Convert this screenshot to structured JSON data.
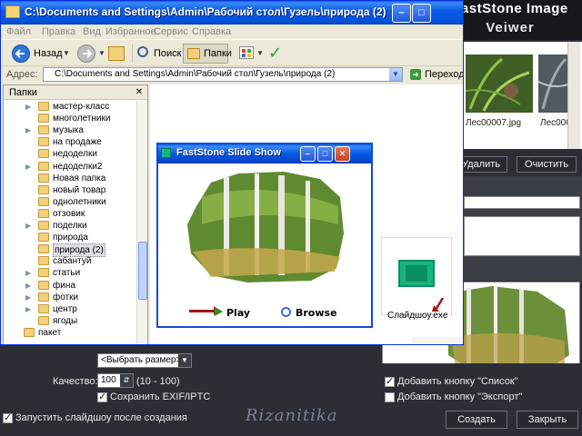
{
  "fs_app": {
    "title_line1": "FastStone Image",
    "title_line2": "Veiwer",
    "thumbs": [
      {
        "label": "Лес00007.jpg"
      },
      {
        "label": "Лес000"
      }
    ],
    "delete_button": "Удалить",
    "clear_button": "Очистить",
    "size_select": "<Выбрать размер>",
    "quality_label": "Качество:",
    "quality_value": "100",
    "quality_range": "(10 - 100)",
    "save_exif_label": "Сохранить EXIF/IPTC",
    "save_exif_checked": true,
    "add_list_button_label": "Добавить кнопку \"Список\"",
    "add_list_checked": true,
    "add_export_button_label": "Добавить кнопку \"Экспорт\"",
    "add_export_checked": false,
    "start_slideshow_label": "Запустить слайдшоу после создания",
    "start_slideshow_checked": true,
    "create_button": "Создать",
    "close_button": "Закрыть",
    "watermark": "Rizanitika"
  },
  "explorer": {
    "title": "C:\\Documents and Settings\\Admin\\Рабочий стол\\Гузель\\природа (2)",
    "menu": [
      "Файл",
      "Правка",
      "Вид",
      "Избранное",
      "Сервис",
      "Справка"
    ],
    "toolbar": {
      "back_label": "Назад",
      "search_label": "Поиск",
      "folders_label": "Папки"
    },
    "address_label": "Адрес:",
    "address_value": "C:\\Documents and Settings\\Admin\\Рабочий стол\\Гузель\\природа (2)",
    "go_label": "Переход",
    "folders_pane_title": "Папки",
    "tree": [
      {
        "label": "мастер-класс",
        "expandable": true
      },
      {
        "label": "многолетники",
        "expandable": false
      },
      {
        "label": "музыка",
        "expandable": true
      },
      {
        "label": "на продаже",
        "expandable": false
      },
      {
        "label": "недоделки",
        "expandable": false
      },
      {
        "label": "недоделки2",
        "expandable": true
      },
      {
        "label": "Новая папка",
        "expandable": false
      },
      {
        "label": "новый товар",
        "expandable": false
      },
      {
        "label": "однолетники",
        "expandable": false
      },
      {
        "label": "отзовик",
        "expandable": false
      },
      {
        "label": "поделки",
        "expandable": true
      },
      {
        "label": "природа",
        "expandable": false
      },
      {
        "label": "природа (2)",
        "expandable": false,
        "selected": true
      },
      {
        "label": "сабантуй",
        "expandable": false
      },
      {
        "label": "статьи",
        "expandable": true
      },
      {
        "label": "фина",
        "expandable": true
      },
      {
        "label": "фотки",
        "expandable": true
      },
      {
        "label": "центр",
        "expandable": true
      },
      {
        "label": "ягоды",
        "expandable": false
      },
      {
        "label": "пакет",
        "expandable": false,
        "top_level": true
      }
    ],
    "file_label": "Слайдшоу.exe"
  },
  "slideshow": {
    "title": "FastStone Slide Show",
    "play_label": "Play",
    "browse_label": "Browse"
  },
  "colors": {
    "xp_title_blue": "#0a5ce5",
    "explorer_face": "#ece9d8",
    "fs_dark": "#2b2f35",
    "green_icon": "#19b37e",
    "red_arrow": "#a31616"
  }
}
